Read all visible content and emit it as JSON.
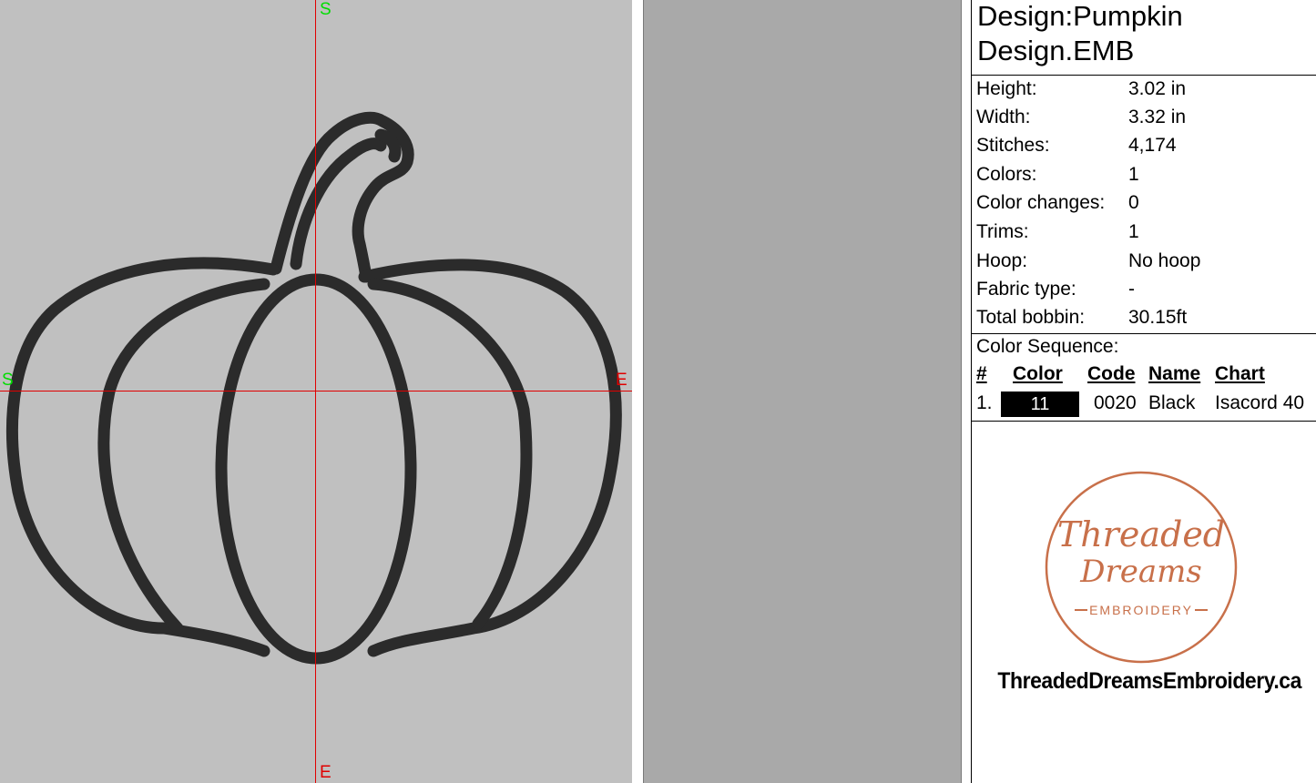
{
  "canvas": {
    "axis_labels": {
      "top": "S",
      "bottom": "E",
      "left": "S",
      "right": "E"
    },
    "axis_colors": {
      "start": "#00dd00",
      "end": "#e00000"
    },
    "background": "#c0c0c0",
    "stitch_color": "#2b2b2b"
  },
  "panel": {
    "title_line1": "Design:Pumpkin",
    "title_line2": "Design.EMB",
    "stats": [
      {
        "key": "Height:",
        "value": "3.02 in"
      },
      {
        "key": "Width:",
        "value": "3.32 in"
      },
      {
        "key": "Stitches:",
        "value": "4,174"
      },
      {
        "key": "Colors:",
        "value": "1"
      },
      {
        "key": "Color changes:",
        "value": "0"
      },
      {
        "key": "Trims:",
        "value": "1"
      },
      {
        "key": "Hoop:",
        "value": "No hoop"
      },
      {
        "key": "Fabric type:",
        "value": "-"
      },
      {
        "key": "Total bobbin:",
        "value": "30.15ft"
      }
    ],
    "color_sequence_label": "Color Sequence:",
    "table_headers": {
      "num": "#",
      "color": "Color",
      "code": "Code",
      "name": "Name",
      "chart": "Chart"
    },
    "table_rows": [
      {
        "num": "1.",
        "color_number": "11",
        "swatch": "#000000",
        "code": "0020",
        "name": "Black",
        "chart": "Isacord 40"
      }
    ]
  },
  "logo": {
    "line1": "Threaded",
    "line2": "Dreams",
    "line3": "EMBROIDERY",
    "color": "#c8704a",
    "website": "ThreadedDreamsEmbroidery.ca"
  }
}
